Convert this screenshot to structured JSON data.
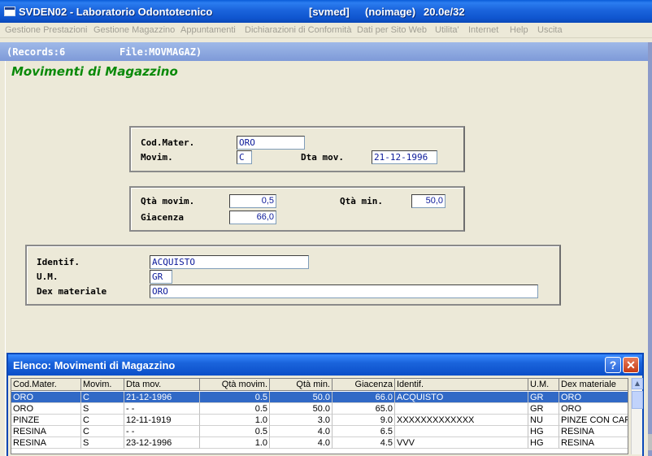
{
  "window": {
    "title_main": "SVDEN02 - Laboratorio Odontotecnico",
    "title_db": "[svmed]",
    "title_image": "(noimage)",
    "title_version": "20.0e/32"
  },
  "menu": {
    "items": [
      "Gestione Prestazioni",
      "Gestione Magazzino",
      "Appuntamenti",
      "Dichiarazioni di Conformità",
      "Dati per Sito Web",
      "Utilita'",
      "Internet",
      "Help",
      "Uscita"
    ]
  },
  "status": {
    "records": "(Records:6",
    "file": "File:MOVMAGAZ)"
  },
  "page_title": "Movimenti di Magazzino",
  "form": {
    "cod_mater_label": "Cod.Mater.",
    "cod_mater_value": "ORO",
    "movim_label": "Movim.",
    "movim_value": "C",
    "dta_mov_label": "Dta mov.",
    "dta_mov_value": "21-12-1996",
    "qta_movim_label": "Qtà movim.",
    "qta_movim_value": "0,5",
    "qta_min_label": "Qtà min.",
    "qta_min_value": "50,0",
    "giacenza_label": "Giacenza",
    "giacenza_value": "66,0",
    "identif_label": "Identif.",
    "identif_value": "ACQUISTO",
    "um_label": "U.M.",
    "um_value": "GR",
    "dex_label": "Dex materiale",
    "dex_value": "ORO"
  },
  "list": {
    "title": "Elenco: Movimenti di Magazzino",
    "help_glyph": "?",
    "close_glyph": "✕",
    "columns": [
      "Cod.Mater.",
      "Movim.",
      "Dta mov.",
      "Qtà movim.",
      "Qtà min.",
      "Giacenza",
      "Identif.",
      "U.M.",
      "Dex materiale"
    ],
    "rows": [
      [
        "ORO",
        "C",
        "21-12-1996",
        "0.5",
        "50.0",
        "66.0",
        "ACQUISTO",
        "GR",
        "ORO"
      ],
      [
        "ORO",
        "S",
        " - -",
        "0.5",
        "50.0",
        "65.0",
        "",
        "GR",
        "ORO"
      ],
      [
        "PINZE",
        "C",
        "12-11-1919",
        "1.0",
        "3.0",
        "9.0",
        "XXXXXXXXXXXXX",
        "NU",
        "PINZE CON CARBURO"
      ],
      [
        "RESINA",
        "C",
        " - -",
        "0.5",
        "4.0",
        "6.5",
        "",
        "HG",
        "RESINA"
      ],
      [
        "RESINA",
        "S",
        "23-12-1996",
        "1.0",
        "4.0",
        "4.5",
        "VVV",
        "HG",
        "RESINA"
      ]
    ],
    "selected_row": 0
  },
  "colors": {
    "title_bar": "#1a64dc",
    "page_title": "#0a8a0a",
    "field_text": "#0c1a9a",
    "selection": "#3169c6"
  }
}
